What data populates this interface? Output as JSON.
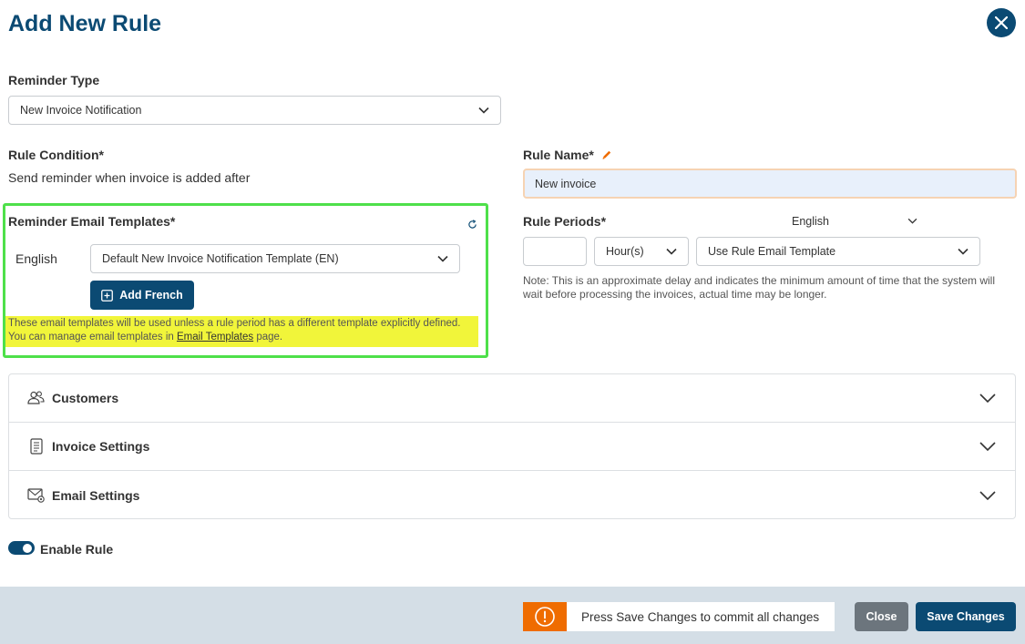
{
  "dialog": {
    "title": "Add New Rule"
  },
  "reminder_type": {
    "label": "Reminder Type",
    "value": "New Invoice Notification"
  },
  "rule_condition": {
    "label": "Rule Condition*",
    "text": "Send reminder when invoice is added after"
  },
  "rule_name": {
    "label": "Rule Name*",
    "value": "New invoice"
  },
  "templates": {
    "label": "Reminder Email Templates*",
    "language": "English",
    "value": "Default New Invoice Notification Template (EN)",
    "add_button": "Add French",
    "note_before": "These email templates will be used unless a rule period has a different template explicitly defined. You can manage email templates in ",
    "note_link": "Email Templates",
    "note_after": " page."
  },
  "rule_periods": {
    "label": "Rule Periods*",
    "language": "English",
    "unit": "Hour(s)",
    "template": "Use Rule Email Template",
    "note": "Note: This is an approximate delay and indicates the minimum amount of time that the system will wait before processing the invoices, actual time may be longer."
  },
  "sections": [
    {
      "label": "Customers",
      "icon": "customers-icon"
    },
    {
      "label": "Invoice Settings",
      "icon": "document-icon"
    },
    {
      "label": "Email Settings",
      "icon": "email-settings-icon"
    }
  ],
  "enable_rule": {
    "label": "Enable Rule",
    "on": true
  },
  "footer": {
    "message": "Press Save Changes to commit all changes",
    "close": "Close",
    "save": "Save Changes"
  },
  "colors": {
    "primary": "#0b4a73",
    "warning": "#ef6c00",
    "highlight": "#f1f53a",
    "annotation_box": "#4ee04a",
    "accent_edit": "#ef6c00"
  }
}
